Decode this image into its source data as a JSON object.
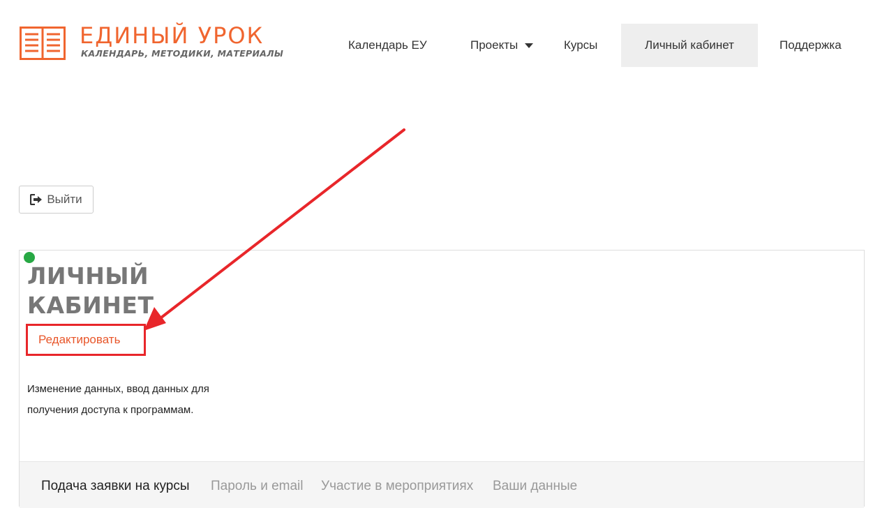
{
  "header": {
    "logo": {
      "title": "ЕДИНЫЙ УРОК",
      "subtitle": "КАЛЕНДАРЬ, МЕТОДИКИ, МАТЕРИАЛЫ",
      "icon": "open-book-icon",
      "color": "#f0652f"
    },
    "nav": [
      {
        "label": "Календарь ЕУ"
      },
      {
        "label": "Проекты",
        "has_dropdown": true
      },
      {
        "label": "Курсы"
      },
      {
        "label": "Личный кабинет",
        "active": true
      },
      {
        "label": "Поддержка"
      }
    ]
  },
  "logout": {
    "label": "Выйти",
    "icon": "sign-out-icon"
  },
  "card": {
    "status_color": "#27a844",
    "title": "ЛИЧНЫЙ КАБИНЕТ",
    "edit_label": "Редактировать",
    "description": "Изменение данных, ввод данных для получения доступа к программам.",
    "tabs": [
      {
        "label": "Подача заявки на курсы",
        "active": true
      },
      {
        "label": "Пароль и email"
      },
      {
        "label": "Участие в мероприятиях"
      },
      {
        "label": "Ваши данные"
      }
    ]
  },
  "annotation": {
    "color": "#e8262a"
  }
}
